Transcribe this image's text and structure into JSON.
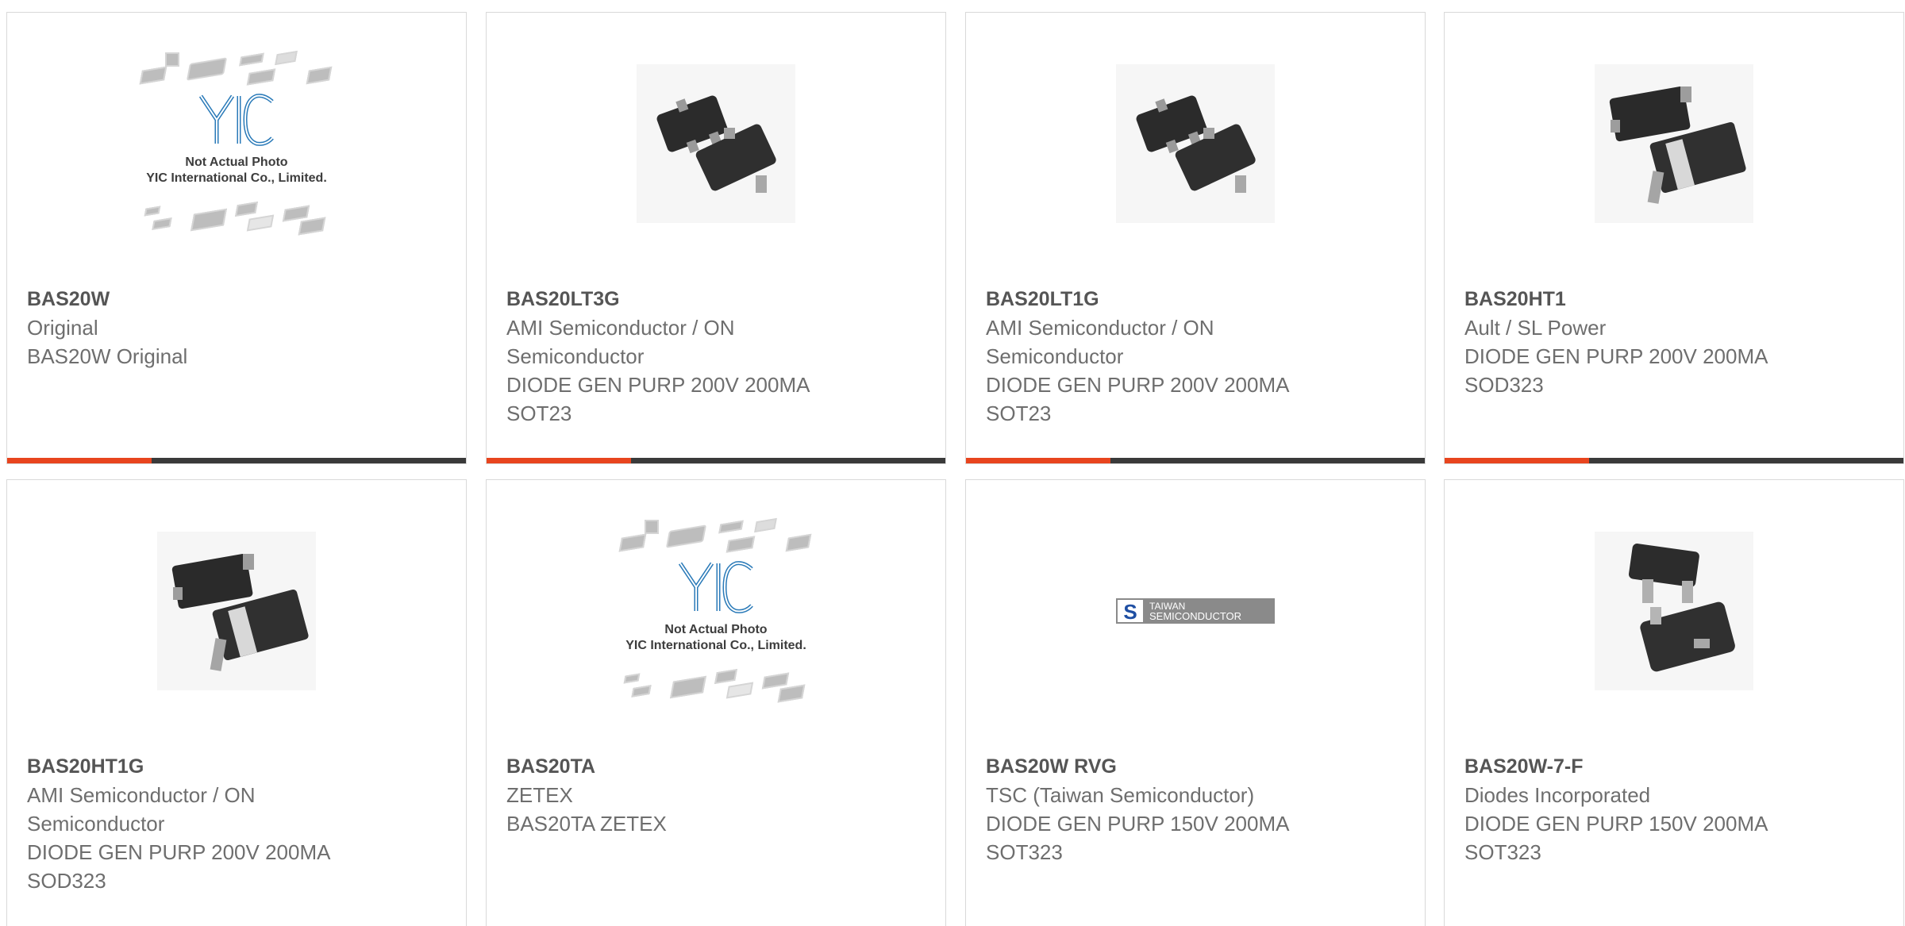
{
  "colors": {
    "accent": "#e8451e",
    "bar_rest": "#3a3a3a"
  },
  "products": [
    {
      "part": "BAS20W",
      "lines": [
        "Original",
        "BAS20W Original"
      ],
      "image": "placeholder"
    },
    {
      "part": "BAS20LT3G",
      "lines": [
        "AMI Semiconductor / ON",
        "Semiconductor",
        "DIODE GEN PURP 200V 200MA",
        "SOT23"
      ],
      "image": "sot23"
    },
    {
      "part": "BAS20LT1G",
      "lines": [
        "AMI Semiconductor / ON",
        "Semiconductor",
        "DIODE GEN PURP 200V 200MA",
        "SOT23"
      ],
      "image": "sot23"
    },
    {
      "part": "BAS20HT1",
      "lines": [
        "Ault / SL Power",
        "DIODE GEN PURP 200V 200MA",
        "SOD323"
      ],
      "image": "sod323"
    },
    {
      "part": "BAS20HT1G",
      "lines": [
        "AMI Semiconductor / ON",
        "Semiconductor",
        "DIODE GEN PURP 200V 200MA",
        "SOD323"
      ],
      "image": "sod323"
    },
    {
      "part": "BAS20TA",
      "lines": [
        "ZETEX",
        "BAS20TA ZETEX"
      ],
      "image": "placeholder"
    },
    {
      "part": "BAS20W RVG",
      "lines": [
        "TSC (Taiwan Semiconductor)",
        "DIODE GEN PURP 150V 200MA",
        "SOT323"
      ],
      "image": "tsc-logo"
    },
    {
      "part": "BAS20W-7-F",
      "lines": [
        "Diodes Incorporated",
        "DIODE GEN PURP 150V 200MA",
        "SOT323"
      ],
      "image": "sot323"
    }
  ],
  "placeholder": {
    "brand": "YIC",
    "line1": "Not Actual Photo",
    "line2": "YIC International Co., Limited."
  },
  "tsc_logo": {
    "line1": "TAIWAN",
    "line2": "SEMICONDUCTOR"
  }
}
